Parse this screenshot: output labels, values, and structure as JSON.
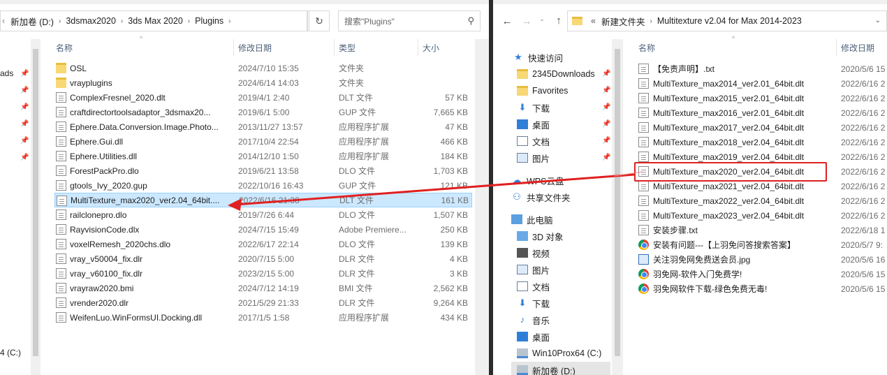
{
  "left": {
    "address": [
      "新加卷 (D:)",
      "3dsmax2020",
      "3ds Max 2020",
      "Plugins"
    ],
    "search_placeholder": "搜索\"Plugins\"",
    "columns": {
      "name": "名称",
      "date": "修改日期",
      "type": "类型",
      "size": "大小"
    },
    "nav_partial": [
      "ads",
      "4 (C:)"
    ],
    "files": [
      {
        "name": "OSL",
        "date": "2024/7/10 15:35",
        "type": "文件夹",
        "size": "",
        "icon": "folder-icon"
      },
      {
        "name": "vrayplugins",
        "date": "2024/6/14 14:03",
        "type": "文件夹",
        "size": "",
        "icon": "folder-icon"
      },
      {
        "name": "ComplexFresnel_2020.dlt",
        "date": "2019/4/1 2:40",
        "type": "DLT 文件",
        "size": "57 KB",
        "icon": "file-icon"
      },
      {
        "name": "craftdirectortoolsadaptor_3dsmax20...",
        "date": "2019/6/1 5:00",
        "type": "GUP 文件",
        "size": "7,665 KB",
        "icon": "file-icon"
      },
      {
        "name": "Ephere.Data.Conversion.Image.Photo...",
        "date": "2013/11/27 13:57",
        "type": "应用程序扩展",
        "size": "47 KB",
        "icon": "file-icon"
      },
      {
        "name": "Ephere.Gui.dll",
        "date": "2017/10/4 22:54",
        "type": "应用程序扩展",
        "size": "466 KB",
        "icon": "file-icon"
      },
      {
        "name": "Ephere.Utilities.dll",
        "date": "2014/12/10 1:50",
        "type": "应用程序扩展",
        "size": "184 KB",
        "icon": "file-icon"
      },
      {
        "name": "ForestPackPro.dlo",
        "date": "2019/6/21 13:58",
        "type": "DLO 文件",
        "size": "1,703 KB",
        "icon": "file-icon"
      },
      {
        "name": "gtools_Ivy_2020.gup",
        "date": "2022/10/16 16:43",
        "type": "GUP 文件",
        "size": "121 KB",
        "icon": "file-icon"
      },
      {
        "name": "MultiTexture_max2020_ver2.04_64bit....",
        "date": "2022/6/16 21:38",
        "type": "DLT 文件",
        "size": "161 KB",
        "icon": "file-icon",
        "selected": true
      },
      {
        "name": "railclonepro.dlo",
        "date": "2019/7/26 6:44",
        "type": "DLO 文件",
        "size": "1,507 KB",
        "icon": "file-icon"
      },
      {
        "name": "RayvisionCode.dlx",
        "date": "2024/7/15 15:49",
        "type": "Adobe Premiere...",
        "size": "250 KB",
        "icon": "file-icon"
      },
      {
        "name": "voxelRemesh_2020chs.dlo",
        "date": "2022/6/17 22:14",
        "type": "DLO 文件",
        "size": "139 KB",
        "icon": "file-icon"
      },
      {
        "name": "vray_v50004_fix.dlr",
        "date": "2020/7/15 5:00",
        "type": "DLR 文件",
        "size": "4 KB",
        "icon": "file-icon"
      },
      {
        "name": "vray_v60100_fix.dlr",
        "date": "2023/2/15 5:00",
        "type": "DLR 文件",
        "size": "3 KB",
        "icon": "file-icon"
      },
      {
        "name": "vrayraw2020.bmi",
        "date": "2024/7/12 14:19",
        "type": "BMI 文件",
        "size": "2,562 KB",
        "icon": "file-icon"
      },
      {
        "name": "vrender2020.dlr",
        "date": "2021/5/29 21:33",
        "type": "DLR 文件",
        "size": "9,264 KB",
        "icon": "file-icon"
      },
      {
        "name": "WeifenLuo.WinFormsUI.Docking.dll",
        "date": "2017/1/5 1:58",
        "type": "应用程序扩展",
        "size": "434 KB",
        "icon": "file-icon"
      }
    ]
  },
  "right": {
    "address": [
      "新建文件夹",
      "Multitexture v2.04 for Max 2014-2023"
    ],
    "address_prefix": "«",
    "columns": {
      "name": "名称",
      "date": "修改日期"
    },
    "nav": [
      {
        "label": "快速访问",
        "icon": "star-icon",
        "pin": false
      },
      {
        "label": "2345Downloads",
        "icon": "folder-icon",
        "pin": true
      },
      {
        "label": "Favorites",
        "icon": "folder-icon",
        "pin": true
      },
      {
        "label": "下载",
        "icon": "download-icon",
        "pin": true
      },
      {
        "label": "桌面",
        "icon": "desktop-icon",
        "pin": true
      },
      {
        "label": "文档",
        "icon": "document-icon",
        "pin": true
      },
      {
        "label": "图片",
        "icon": "picture-icon",
        "pin": true
      },
      {
        "label": "WPS云盘",
        "icon": "cloud-icon",
        "pin": false
      },
      {
        "label": "共享文件夹",
        "icon": "shared-folder-icon",
        "pin": false
      },
      {
        "label": "此电脑",
        "icon": "computer-icon",
        "pin": false
      },
      {
        "label": "3D 对象",
        "icon": "3d-objects-icon",
        "pin": false
      },
      {
        "label": "视频",
        "icon": "video-icon",
        "pin": false
      },
      {
        "label": "图片",
        "icon": "picture-icon",
        "pin": false
      },
      {
        "label": "文档",
        "icon": "document-icon",
        "pin": false
      },
      {
        "label": "下载",
        "icon": "download-icon",
        "pin": false
      },
      {
        "label": "音乐",
        "icon": "music-icon",
        "pin": false
      },
      {
        "label": "桌面",
        "icon": "desktop-icon",
        "pin": false
      },
      {
        "label": "Win10Prox64 (C:)",
        "icon": "drive-icon",
        "pin": false
      },
      {
        "label": "新加卷 (D:)",
        "icon": "drive-icon",
        "pin": false
      }
    ],
    "files": [
      {
        "name": "【免责声明】.txt",
        "date": "2020/5/6 15",
        "icon": "file-icon"
      },
      {
        "name": "MultiTexture_max2014_ver2.01_64bit.dlt",
        "date": "2022/6/16 2",
        "icon": "file-icon"
      },
      {
        "name": "MultiTexture_max2015_ver2.01_64bit.dlt",
        "date": "2022/6/16 2",
        "icon": "file-icon"
      },
      {
        "name": "MultiTexture_max2016_ver2.01_64bit.dlt",
        "date": "2022/6/16 2",
        "icon": "file-icon"
      },
      {
        "name": "MultiTexture_max2017_ver2.04_64bit.dlt",
        "date": "2022/6/16 2",
        "icon": "file-icon"
      },
      {
        "name": "MultiTexture_max2018_ver2.04_64bit.dlt",
        "date": "2022/6/16 2",
        "icon": "file-icon"
      },
      {
        "name": "MultiTexture_max2019_ver2.04_64bit.dlt",
        "date": "2022/6/16 2",
        "icon": "file-icon"
      },
      {
        "name": "MultiTexture_max2020_ver2.04_64bit.dlt",
        "date": "2022/6/16 2",
        "icon": "file-icon",
        "highlighted": true
      },
      {
        "name": "MultiTexture_max2021_ver2.04_64bit.dlt",
        "date": "2022/6/16 2",
        "icon": "file-icon"
      },
      {
        "name": "MultiTexture_max2022_ver2.04_64bit.dlt",
        "date": "2022/6/16 2",
        "icon": "file-icon"
      },
      {
        "name": "MultiTexture_max2023_ver2.04_64bit.dlt",
        "date": "2022/6/16 2",
        "icon": "file-icon"
      },
      {
        "name": "安装步骤.txt",
        "date": "2022/6/18 1",
        "icon": "file-icon"
      },
      {
        "name": "安装有问题---【上羽免问答搜索答案】",
        "date": "2020/5/7 9:",
        "icon": "chrome-icon"
      },
      {
        "name": "关注羽免网免费送会员.jpg",
        "date": "2020/5/6 16",
        "icon": "image-icon"
      },
      {
        "name": "羽免网-软件入门免费学!",
        "date": "2020/5/6 15",
        "icon": "chrome-icon"
      },
      {
        "name": "羽免网软件下载-绿色免费无毒!",
        "date": "2020/5/6 15",
        "icon": "chrome-icon"
      }
    ]
  },
  "colors": {
    "selection": "#cce8ff",
    "highlight_box": "#e02020",
    "arrow": "#e02020"
  }
}
